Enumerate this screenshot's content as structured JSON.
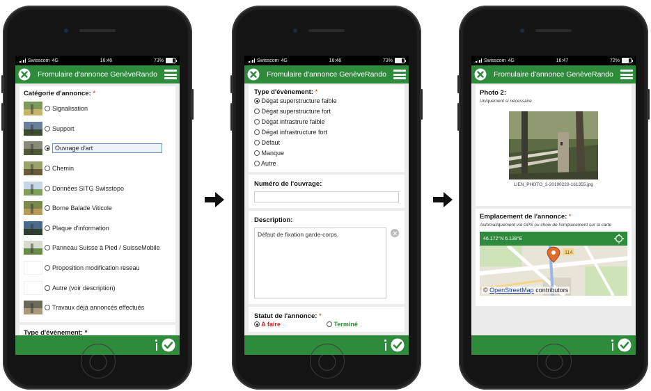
{
  "colors": {
    "header_green": "#2e8b3c",
    "required_red": "#d21f1f",
    "status_todo": "#d21f1f",
    "status_done": "#2e8b3c"
  },
  "screens": [
    {
      "status": {
        "carrier": "Swisscom",
        "network": "4G",
        "time": "16:46",
        "battery": "73%",
        "battery_level": 0.73
      },
      "header": {
        "title": "Fromulaire d'annonce GenèveRando"
      },
      "category_label": "Catégorie d'annonce:",
      "required_mark": "*",
      "categories": [
        {
          "label": "Signalisation",
          "icon": "signpost-photo",
          "selected": false
        },
        {
          "label": "Support",
          "icon": "post-photo",
          "selected": false
        },
        {
          "label": "Ouvrage d'art",
          "icon": "bridge-photo",
          "selected": true
        },
        {
          "label": "Chemin",
          "icon": "path-photo",
          "selected": false
        },
        {
          "label": "Données SITG Swisstopo",
          "icon": "map-data-photo",
          "selected": false
        },
        {
          "label": "Borne Balade Viticole",
          "icon": "vineyard-marker-photo",
          "selected": false
        },
        {
          "label": "Plaque d'information",
          "icon": "info-plate-photo",
          "selected": false
        },
        {
          "label": "Panneau Suisse à Pied / SuisseMobile",
          "icon": "trail-sign-photo",
          "selected": false
        },
        {
          "label": "Proposition modification reseau",
          "icon": "",
          "selected": false
        },
        {
          "label": "Autre (voir description)",
          "icon": "",
          "selected": false
        },
        {
          "label": "Travaux déjà annoncés effectués",
          "icon": "works-photo",
          "selected": false
        }
      ],
      "next_label": "Type d'évènement: *"
    },
    {
      "status": {
        "carrier": "Swisscom",
        "network": "4G",
        "time": "16:46",
        "battery": "73%",
        "battery_level": 0.73
      },
      "header": {
        "title": "Fromulaire d'annonce GenèveRando"
      },
      "event_label": "Type d'évènement:",
      "required_mark": "*",
      "events": [
        {
          "label": "Dégat superstructure faible",
          "selected": true
        },
        {
          "label": "Dégat superstructure fort",
          "selected": false
        },
        {
          "label": "Dégat infrastrure faible",
          "selected": false
        },
        {
          "label": "Dégat infrastructure fort",
          "selected": false
        },
        {
          "label": "Défaut",
          "selected": false
        },
        {
          "label": "Manque",
          "selected": false
        },
        {
          "label": "Autre",
          "selected": false
        }
      ],
      "work_number_label": "Numéro de l'ouvrage:",
      "work_number_value": "",
      "description_label": "Description:",
      "description_value": "Défaut de fixation garde-corps.",
      "status_label": "Statut de l'annonce:",
      "status_todo": "A faire",
      "status_done": "Terminé",
      "status_todo_selected": true
    },
    {
      "status": {
        "carrier": "Swisscom",
        "network": "4G",
        "time": "16:47",
        "battery": "72%",
        "battery_level": 0.72
      },
      "header": {
        "title": "Fromulaire d'annonce GenèveRando"
      },
      "photo_label": "Photo 2:",
      "photo_hint": "Uniquement si nécessaire",
      "photo_filename": "LIEN_PHOTO_2-20190220-161355.jpg",
      "location_label": "Emplacement de l'annonce:",
      "required_mark": "*",
      "location_hint": "Automatiquement via GPS ou choix de l'emplacement sur la carte",
      "coords": "46.172°N 6.138°E",
      "map_number": "114",
      "attribution_symbol": "©",
      "attribution_link": "OpenStreetMap",
      "attribution_text": "contributors"
    }
  ]
}
